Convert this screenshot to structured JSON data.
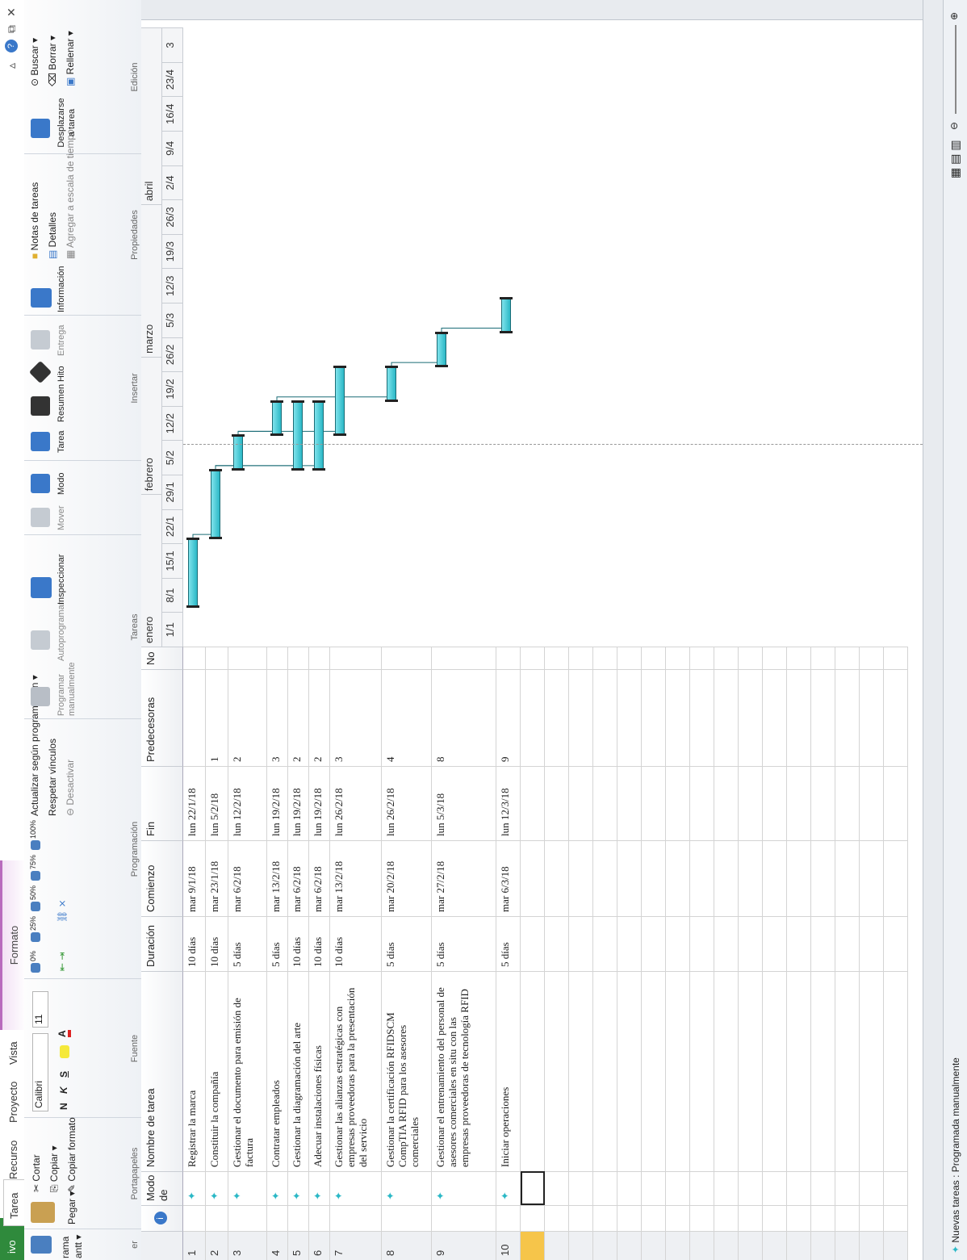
{
  "tabs": {
    "file": "ivo",
    "tarea": "Tarea",
    "recurso": "Recurso",
    "proyecto": "Proyecto",
    "vista": "Vista",
    "formato": "Formato"
  },
  "ribbon": {
    "view": {
      "label1": "rama",
      "label2": "antt ▾",
      "group": "er"
    },
    "clipboard": {
      "paste": "Pegar ▾",
      "cut": "Cortar",
      "copy": "Copiar ▾",
      "copy_format": "Copiar formato",
      "group": "Portapapeles"
    },
    "font": {
      "name": "Calibri",
      "size": "11",
      "bold": "N",
      "italic": "K",
      "underline": "S",
      "group": "Fuente"
    },
    "schedule": {
      "p0": "0%",
      "p25": "25%",
      "p50": "50%",
      "p75": "75%",
      "p100": "100%",
      "update": "Actualizar según programación ▾",
      "respect": "Respetar vínculos",
      "deactivate": "Desactivar",
      "group": "Programación"
    },
    "tasks": {
      "manual": "Programar manualmente",
      "auto": "Autoprogramar",
      "inspect": "Inspeccionar",
      "move": "Mover",
      "mode": "Modo",
      "group": "Tareas"
    },
    "insert": {
      "task": "Tarea",
      "summary": "Resumen",
      "milestone": "Hito",
      "deliverable": "Entrega",
      "group": "Insertar"
    },
    "properties": {
      "info": "Información",
      "notes": "Notas de tareas",
      "details": "Detalles",
      "timeline": "Agregar a escala de tiempo",
      "group": "Propiedades"
    },
    "editing": {
      "scroll": "Desplazarse a tarea",
      "find": "Buscar ▾",
      "clear": "Borrar ▾",
      "fill": "Rellenar ▾",
      "group": "Edición"
    }
  },
  "columns": {
    "info": "i",
    "mode": "Modo de",
    "name": "Nombre de tarea",
    "duration": "Duración",
    "start": "Comienzo",
    "end": "Fin",
    "pred": "Predecesoras",
    "extra": "No"
  },
  "tasks": [
    {
      "id": "1",
      "name": "Registrar la marca",
      "duration": "10 días",
      "start": "mar 9/1/18",
      "end": "lun 22/1/18",
      "pred": ""
    },
    {
      "id": "2",
      "name": "Constituir la compañía",
      "duration": "10 días",
      "start": "mar 23/1/18",
      "end": "lun 5/2/18",
      "pred": "1"
    },
    {
      "id": "3",
      "name": "Gestionar el documento para emisión de factura",
      "duration": "5 días",
      "start": "mar 6/2/18",
      "end": "lun 12/2/18",
      "pred": "2"
    },
    {
      "id": "4",
      "name": "Contratar empleados",
      "duration": "5 días",
      "start": "mar 13/2/18",
      "end": "lun 19/2/18",
      "pred": "3"
    },
    {
      "id": "5",
      "name": "Gestionar la diagramación del arte",
      "duration": "10 días",
      "start": "mar 6/2/18",
      "end": "lun 19/2/18",
      "pred": "2"
    },
    {
      "id": "6",
      "name": "Adecuar instalaciones físicas",
      "duration": "10 días",
      "start": "mar 6/2/18",
      "end": "lun 19/2/18",
      "pred": "2"
    },
    {
      "id": "7",
      "name": "Gestionar las alianzas estratégicas con empresas proveedoras para la presentación del servicio",
      "duration": "10 días",
      "start": "mar 13/2/18",
      "end": "lun 26/2/18",
      "pred": "3"
    },
    {
      "id": "8",
      "name": "Gestionar la certificación RFIDSCM CompTIA RFID para los asesores comerciales",
      "duration": "5 días",
      "start": "mar 20/2/18",
      "end": "lun 26/2/18",
      "pred": "4"
    },
    {
      "id": "9",
      "name": "Gestionar el entrenamiento del personal de asesores comerciales en situ con las empresas proveedoras de tecnología RFID",
      "duration": "5 días",
      "start": "mar 27/2/18",
      "end": "lun 5/3/18",
      "pred": "8"
    },
    {
      "id": "10",
      "name": "Iniciar operaciones",
      "duration": "5 días",
      "start": "mar 6/3/18",
      "end": "lun 12/3/18",
      "pred": "9"
    }
  ],
  "timeline": {
    "months": [
      "enero",
      "febrero",
      "marzo",
      "abril"
    ],
    "weeks": [
      "1/1",
      "8/1",
      "15/1",
      "22/1",
      "29/1",
      "5/2",
      "12/2",
      "19/2",
      "26/2",
      "5/3",
      "12/3",
      "19/3",
      "26/3",
      "2/4",
      "9/4",
      "16/4",
      "23/4",
      "3"
    ]
  },
  "status": {
    "text": "Nuevas tareas : Programada manualmente"
  },
  "colors": {
    "file_tab": "#2f8a3c",
    "bar": "#2bb8c6",
    "context_tab": "#b86bbd"
  }
}
